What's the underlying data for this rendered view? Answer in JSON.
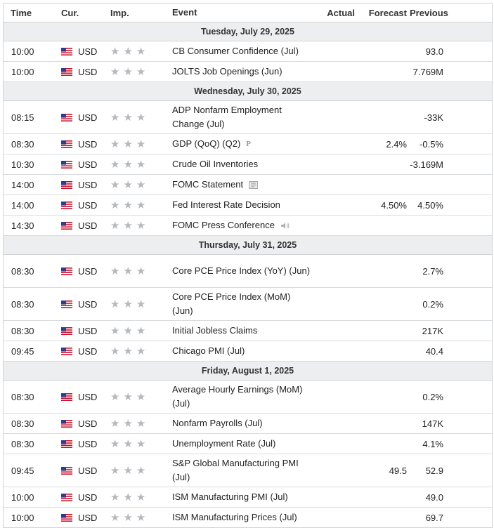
{
  "headers": {
    "time": "Time",
    "cur": "Cur.",
    "imp": "Imp.",
    "event": "Event",
    "actual": "Actual",
    "forecast": "Forecast",
    "previous": "Previous"
  },
  "days": [
    {
      "label": "Tuesday, July 29, 2025",
      "events": [
        {
          "time": "10:00",
          "cur": "USD",
          "stars": 3,
          "event": "CB Consumer Confidence (Jul)",
          "actual": "",
          "forecast": "",
          "previous": "93.0",
          "icon": "",
          "tall": false
        },
        {
          "time": "10:00",
          "cur": "USD",
          "stars": 3,
          "event": "JOLTS Job Openings (Jun)",
          "actual": "",
          "forecast": "",
          "previous": "7.769M",
          "icon": "",
          "tall": false
        }
      ]
    },
    {
      "label": "Wednesday, July 30, 2025",
      "events": [
        {
          "time": "08:15",
          "cur": "USD",
          "stars": 3,
          "event": "ADP Nonfarm Employment Change (Jul)",
          "actual": "",
          "forecast": "",
          "previous": "-33K",
          "icon": "",
          "tall": true
        },
        {
          "time": "08:30",
          "cur": "USD",
          "stars": 3,
          "event": "GDP (QoQ) (Q2)",
          "actual": "",
          "forecast": "2.4%",
          "previous": "-0.5%",
          "icon": "preliminary-icon",
          "tall": false
        },
        {
          "time": "10:30",
          "cur": "USD",
          "stars": 3,
          "event": "Crude Oil Inventories",
          "actual": "",
          "forecast": "",
          "previous": "-3.169M",
          "icon": "",
          "tall": false
        },
        {
          "time": "14:00",
          "cur": "USD",
          "stars": 3,
          "event": "FOMC Statement",
          "actual": "",
          "forecast": "",
          "previous": "",
          "icon": "document-icon",
          "tall": false
        },
        {
          "time": "14:00",
          "cur": "USD",
          "stars": 3,
          "event": "Fed Interest Rate Decision",
          "actual": "",
          "forecast": "4.50%",
          "previous": "4.50%",
          "icon": "",
          "tall": false
        },
        {
          "time": "14:30",
          "cur": "USD",
          "stars": 3,
          "event": "FOMC Press Conference",
          "actual": "",
          "forecast": "",
          "previous": "",
          "icon": "speaker-icon",
          "tall": false
        }
      ]
    },
    {
      "label": "Thursday, July 31, 2025",
      "events": [
        {
          "time": "08:30",
          "cur": "USD",
          "stars": 3,
          "event": "Core PCE Price Index (YoY) (Jun)",
          "actual": "",
          "forecast": "",
          "previous": "2.7%",
          "icon": "",
          "tall": true
        },
        {
          "time": "08:30",
          "cur": "USD",
          "stars": 3,
          "event": "Core PCE Price Index (MoM) (Jun)",
          "actual": "",
          "forecast": "",
          "previous": "0.2%",
          "icon": "",
          "tall": true
        },
        {
          "time": "08:30",
          "cur": "USD",
          "stars": 3,
          "event": "Initial Jobless Claims",
          "actual": "",
          "forecast": "",
          "previous": "217K",
          "icon": "",
          "tall": false
        },
        {
          "time": "09:45",
          "cur": "USD",
          "stars": 3,
          "event": "Chicago PMI (Jul)",
          "actual": "",
          "forecast": "",
          "previous": "40.4",
          "icon": "",
          "tall": false
        }
      ]
    },
    {
      "label": "Friday, August 1, 2025",
      "events": [
        {
          "time": "08:30",
          "cur": "USD",
          "stars": 3,
          "event": "Average Hourly Earnings (MoM) (Jul)",
          "actual": "",
          "forecast": "",
          "previous": "0.2%",
          "icon": "",
          "tall": true
        },
        {
          "time": "08:30",
          "cur": "USD",
          "stars": 3,
          "event": "Nonfarm Payrolls (Jul)",
          "actual": "",
          "forecast": "",
          "previous": "147K",
          "icon": "",
          "tall": false
        },
        {
          "time": "08:30",
          "cur": "USD",
          "stars": 3,
          "event": "Unemployment Rate (Jul)",
          "actual": "",
          "forecast": "",
          "previous": "4.1%",
          "icon": "",
          "tall": false
        },
        {
          "time": "09:45",
          "cur": "USD",
          "stars": 3,
          "event": "S&P Global Manufacturing PMI (Jul)",
          "actual": "",
          "forecast": "49.5",
          "previous": "52.9",
          "icon": "",
          "tall": true
        },
        {
          "time": "10:00",
          "cur": "USD",
          "stars": 3,
          "event": "ISM Manufacturing PMI (Jul)",
          "actual": "",
          "forecast": "",
          "previous": "49.0",
          "icon": "",
          "tall": false
        },
        {
          "time": "10:00",
          "cur": "USD",
          "stars": 3,
          "event": "ISM Manufacturing Prices (Jul)",
          "actual": "",
          "forecast": "",
          "previous": "69.7",
          "icon": "",
          "tall": false
        }
      ]
    }
  ],
  "colors": {
    "star": "#b5b8bc",
    "day_header_bg": "#eceef0",
    "border": "#cfd3d8",
    "text": "#222222"
  }
}
